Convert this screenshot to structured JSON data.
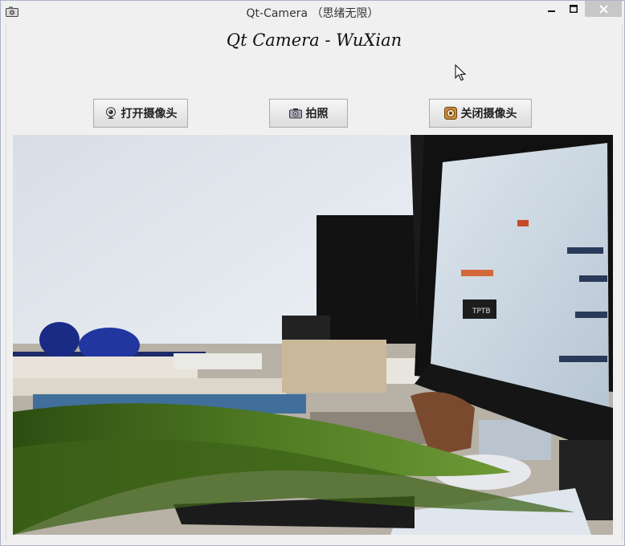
{
  "window": {
    "title": "Qt-Camera （思绪无限）",
    "controls": {
      "minimize": "—",
      "maximize": "□",
      "close": "✕"
    }
  },
  "header": {
    "heading": "Qt Camera - WuXian"
  },
  "toolbar": {
    "open_camera_label": "打开摄像头",
    "open_camera_icon": "webcam-icon",
    "capture_label": "拍照",
    "capture_icon": "camera-icon",
    "close_camera_label": "关闭摄像头",
    "close_camera_icon": "close-camera-icon"
  },
  "viewfinder": {
    "monitor_button_label": "ТРТВ"
  },
  "colors": {
    "window_bg": "#f0f0f0",
    "close_button_bg": "#c7c7c7",
    "button_border": "#adadad"
  }
}
